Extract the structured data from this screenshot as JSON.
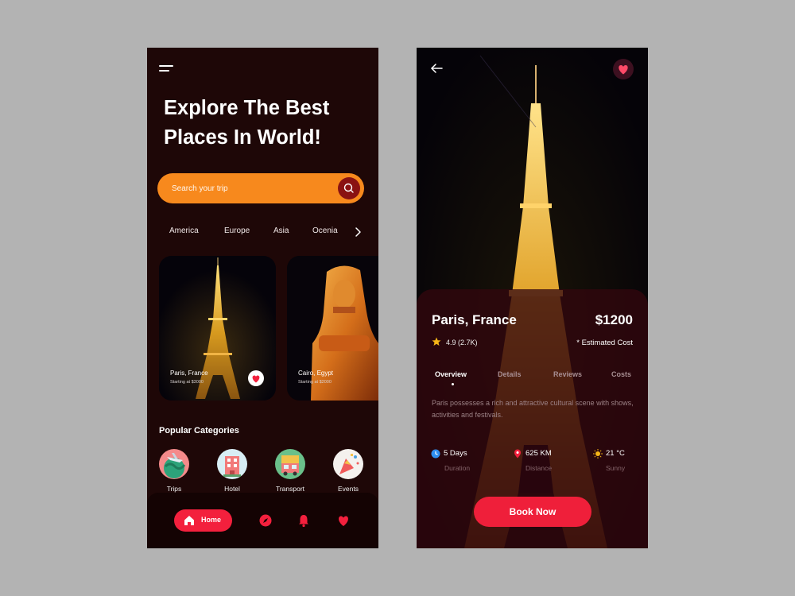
{
  "explore_screen": {
    "title": "Explore The Best Places In World!",
    "search": {
      "placeholder": "Search your trip"
    },
    "regions": [
      "America",
      "Europe",
      "Asia",
      "Ocenia"
    ],
    "destinations": [
      {
        "name": "Paris, France",
        "subtitle": "Starting at $3000"
      },
      {
        "name": "Cairo, Egypt",
        "subtitle": "Starting at $2000"
      }
    ],
    "popular_categories_title": "Popular Categories",
    "categories": [
      "Trips",
      "Hotel",
      "Transport",
      "Events"
    ],
    "bottom_nav": {
      "home_label": "Home",
      "icons": [
        "home-icon",
        "compass-icon",
        "bell-icon",
        "heart-icon"
      ]
    }
  },
  "detail_screen": {
    "place": "Paris, France",
    "price": "$1200",
    "rating": "4.9 (2.7K)",
    "estimated_cost": "* Estimated Cost",
    "tabs": [
      "Overview",
      "Details",
      "Reviews",
      "Costs"
    ],
    "active_tab": "Overview",
    "description": "Paris possesses a rich and attractive cultural scene with shows, activities and festivals.",
    "stats": [
      {
        "value": "5 Days",
        "label": "Duration",
        "icon": "clock-icon"
      },
      {
        "value": "625 KM",
        "label": "Distance",
        "icon": "location-pin-icon"
      },
      {
        "value": "21 °C",
        "label": "Sunny",
        "icon": "sun-icon"
      }
    ],
    "book_label": "Book Now"
  },
  "colors": {
    "orange_accent": "#f7891d",
    "red_accent": "#f3203d",
    "left_background": "#1e0707",
    "sheet_background": "#32060e",
    "star_gold": "#f5b518"
  }
}
